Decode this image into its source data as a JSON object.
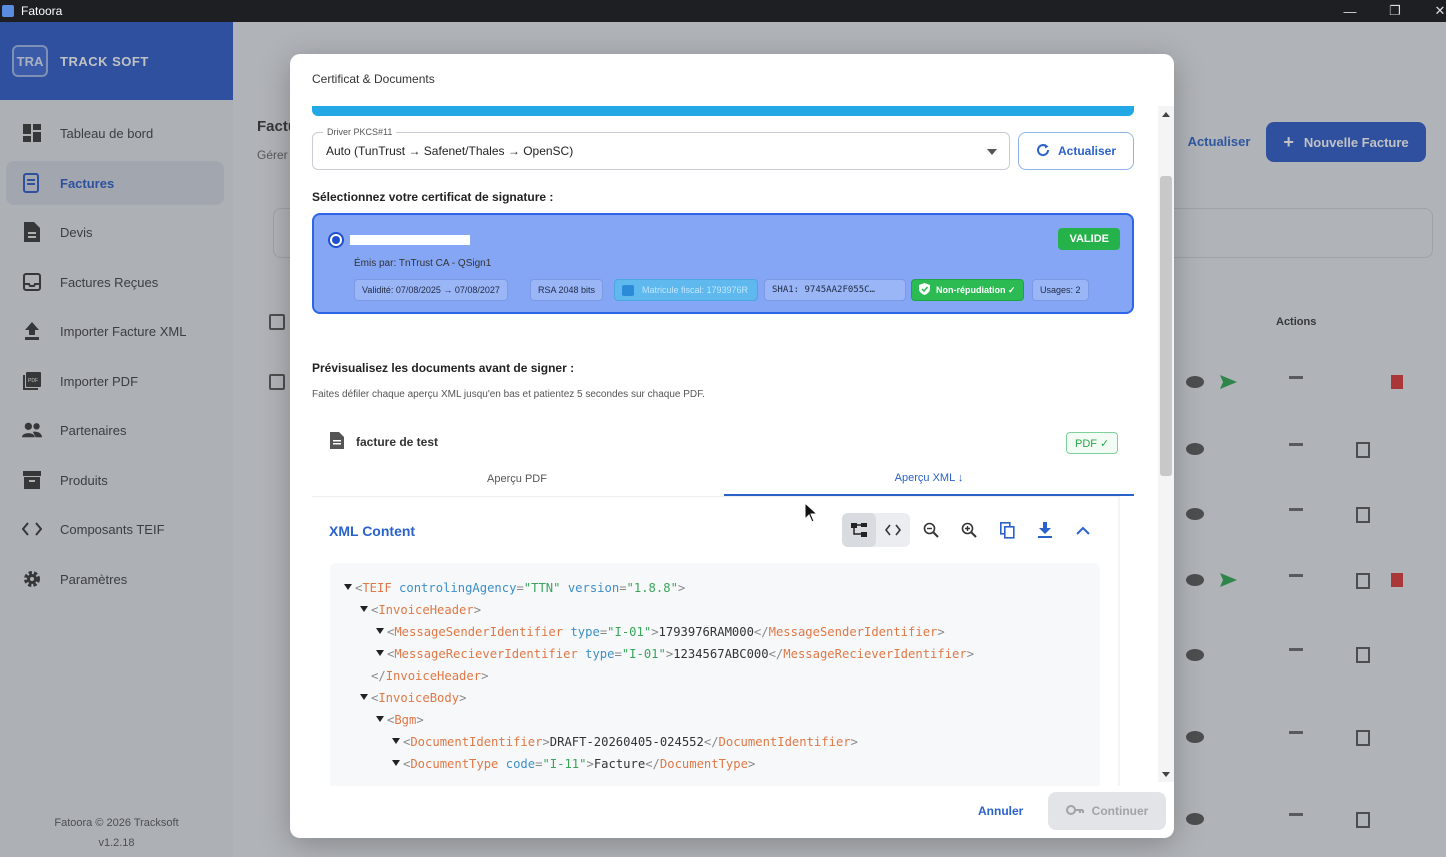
{
  "window": {
    "title": "Fatoora",
    "minimize": "—",
    "maximize": "❐",
    "close": "✕"
  },
  "sidebar": {
    "logo": "TRA",
    "brand": "TRACK SOFT",
    "items": [
      {
        "label": "Tableau de bord",
        "icon": "dashboard-icon"
      },
      {
        "label": "Factures",
        "icon": "invoice-icon"
      },
      {
        "label": "Devis",
        "icon": "quote-icon"
      },
      {
        "label": "Factures Reçues",
        "icon": "inbox-icon"
      },
      {
        "label": "Importer Facture XML",
        "icon": "upload-icon"
      },
      {
        "label": "Importer PDF",
        "icon": "pdf-icon"
      },
      {
        "label": "Partenaires",
        "icon": "people-icon"
      },
      {
        "label": "Produits",
        "icon": "archive-icon"
      },
      {
        "label": "Composants TEIF",
        "icon": "code-icon"
      },
      {
        "label": "Paramètres",
        "icon": "gear-icon"
      }
    ],
    "footer_copyright": "Fatoora © 2026 Tracksoft",
    "footer_version": "v1.2.18"
  },
  "background": {
    "page_title": "Factu",
    "page_subtitle": "Gérer",
    "actualiser": "Actualiser",
    "new_invoice": "Nouvelle Facture",
    "actions_header": "Actions"
  },
  "modal": {
    "title": "Certificat & Documents",
    "driver_label": "Driver PKCS#11",
    "driver_value": "Auto (TunTrust → Safenet/Thales → OpenSC)",
    "refresh": "Actualiser",
    "select_cert": "Sélectionnez votre certificat de signature :",
    "cert": {
      "status": "VALIDE",
      "issuer": "Émis par: TnTrust CA - QSign1",
      "validity": "Validité: 07/08/2025 → 07/08/2027",
      "key": "RSA 2048 bits",
      "fiscal": "Matricule fiscal: 1793976R",
      "sha": "SHA1: 9745AA2F055C…",
      "nonrep": "Non-répudiation ✓",
      "usages": "Usages: 2"
    },
    "preview_heading": "Prévisualisez les documents avant de signer :",
    "preview_hint": "Faites défiler chaque aperçu XML jusqu'en bas et patientez 5 secondes sur chaque PDF.",
    "document_name": "facture de test",
    "pdf_badge": "PDF ✓",
    "tab_pdf": "Aperçu PDF",
    "tab_xml": "Aperçu XML ↓",
    "xml_title": "XML Content",
    "xml": {
      "l1_tag": "TEIF",
      "l1_attr1": "controlingAgency",
      "l1_val1": "\"TTN\"",
      "l1_attr2": "version",
      "l1_val2": "\"1.8.8\"",
      "l2_tag": "InvoiceHeader",
      "l3_tag": "MessageSenderIdentifier",
      "l3_attr": "type",
      "l3_val": "\"I-01\"",
      "l3_text": "1793976RAM000",
      "l4_tag": "MessageRecieverIdentifier",
      "l4_attr": "type",
      "l4_val": "\"I-01\"",
      "l4_text": "1234567ABC000",
      "l5_tag": "InvoiceHeader",
      "l6_tag": "InvoiceBody",
      "l7_tag": "Bgm",
      "l8_tag": "DocumentIdentifier",
      "l8_text": "DRAFT-20260405-024552",
      "l9_tag": "DocumentType",
      "l9_attr": "code",
      "l9_val": "\"I-11\"",
      "l9_text": "Facture"
    },
    "cancel": "Annuler",
    "continue": "Continuer"
  }
}
